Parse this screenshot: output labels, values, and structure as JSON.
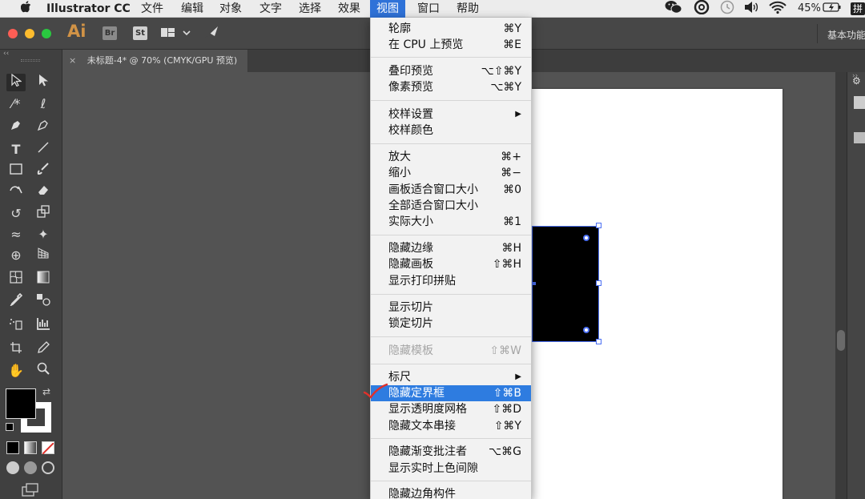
{
  "menubar": {
    "apple": "",
    "app_name": "Illustrator CC",
    "items": [
      "文件",
      "编辑",
      "对象",
      "文字",
      "选择",
      "效果",
      "视图",
      "窗口",
      "帮助"
    ],
    "battery": "45%",
    "input_method": "拼"
  },
  "appbar": {
    "logo": "Ai",
    "br": "Br",
    "st": "St",
    "workspace": "基本功能"
  },
  "document_tab": {
    "close": "×",
    "title": "未标题-4* @ 70% (CMYK/GPU 预览)"
  },
  "view_menu": {
    "items": [
      {
        "label": "轮廓",
        "shortcut": "⌘Y"
      },
      {
        "label": "在 CPU 上预览",
        "shortcut": "⌘E"
      },
      {
        "label": "叠印预览",
        "shortcut": "⌥⇧⌘Y"
      },
      {
        "label": "像素预览",
        "shortcut": "⌥⌘Y"
      },
      {
        "label": "校样设置",
        "shortcut": "▶"
      },
      {
        "label": "校样颜色",
        "shortcut": ""
      },
      {
        "label": "放大",
        "shortcut": "⌘+"
      },
      {
        "label": "缩小",
        "shortcut": "⌘−"
      },
      {
        "label": "画板适合窗口大小",
        "shortcut": "⌘0"
      },
      {
        "label": "全部适合窗口大小",
        "shortcut": ""
      },
      {
        "label": "实际大小",
        "shortcut": "⌘1"
      },
      {
        "label": "隐藏边缘",
        "shortcut": "⌘H"
      },
      {
        "label": "隐藏画板",
        "shortcut": "⇧⌘H"
      },
      {
        "label": "显示打印拼贴",
        "shortcut": ""
      },
      {
        "label": "显示切片",
        "shortcut": ""
      },
      {
        "label": "锁定切片",
        "shortcut": ""
      },
      {
        "label": "隐藏模板",
        "shortcut": "⇧⌘W"
      },
      {
        "label": "标尺",
        "shortcut": "▶"
      },
      {
        "label": "隐藏定界框",
        "shortcut": "⇧⌘B"
      },
      {
        "label": "显示透明度网格",
        "shortcut": "⇧⌘D"
      },
      {
        "label": "隐藏文本串接",
        "shortcut": "⇧⌘Y"
      },
      {
        "label": "隐藏渐变批注者",
        "shortcut": "⌥⌘G"
      },
      {
        "label": "显示实时上色间隙",
        "shortcut": ""
      },
      {
        "label": "隐藏边角构件",
        "shortcut": ""
      }
    ]
  },
  "colors": {
    "menu_highlight": "#2e7ce0",
    "ai_logo": "#d19346",
    "annotation": "#e0312b"
  }
}
